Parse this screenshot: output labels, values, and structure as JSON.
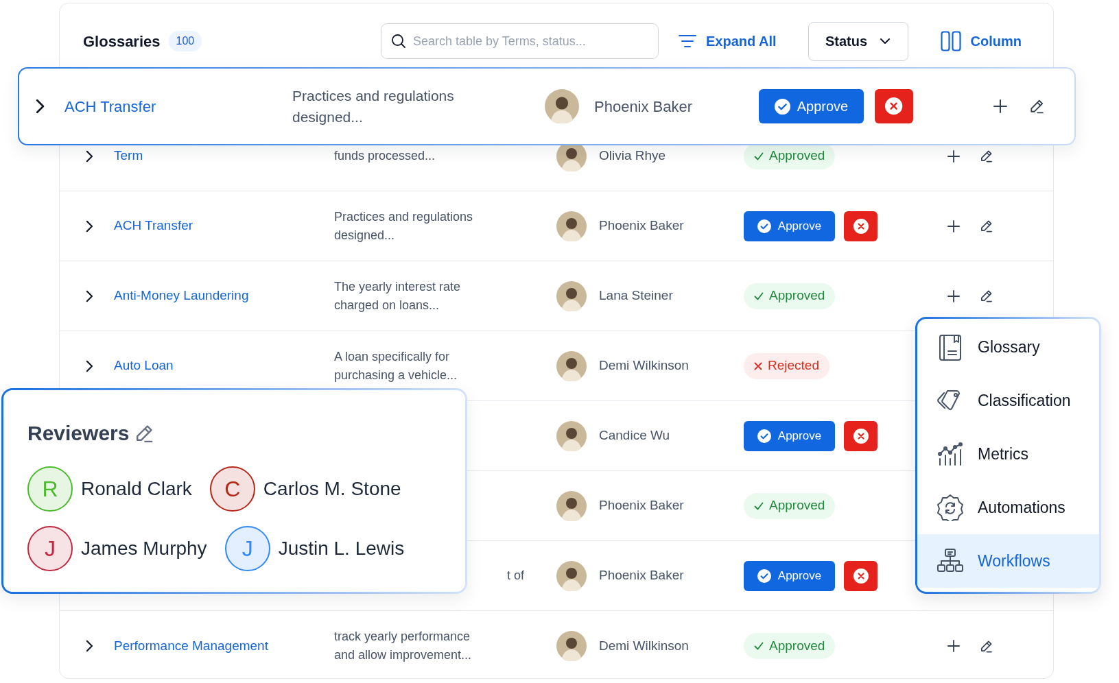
{
  "header": {
    "title": "Glossaries",
    "count": "100",
    "search": {
      "placeholder": "Search table by Terms, status..."
    },
    "expand_label": "Expand All",
    "status_filter": "Status",
    "column_label": "Column"
  },
  "highlighted_row": {
    "term": "ACH Transfer",
    "description": "Practices and regulations\ndesigned...",
    "reviewer": "Phoenix Baker",
    "status": {
      "kind": "pending",
      "label": "Approve"
    },
    "actions": true
  },
  "rows": [
    {
      "term": "Term",
      "description": "funds processed...",
      "reviewer": "Olivia Rhye",
      "status": {
        "kind": "approved",
        "label": "Approved"
      },
      "actions": true
    },
    {
      "term": "ACH Transfer",
      "description": "Practices and regulations\ndesigned...",
      "reviewer": "Phoenix Baker",
      "status": {
        "kind": "pending",
        "label": "Approve"
      },
      "actions": true
    },
    {
      "term": "Anti-Money Laundering",
      "description": "The yearly interest rate\ncharged on loans...",
      "reviewer": "Lana Steiner",
      "status": {
        "kind": "approved",
        "label": "Approved"
      },
      "actions": true
    },
    {
      "term": "Auto Loan",
      "description": "A loan specifically for\npurchasing a vehicle...",
      "reviewer": "Demi Wilkinson",
      "status": {
        "kind": "rejected",
        "label": "Rejected"
      },
      "actions": false
    },
    {
      "reviewer": "Candice Wu",
      "status": {
        "kind": "pending",
        "label": "Approve"
      },
      "actions": false
    },
    {
      "reviewer": "Phoenix Baker",
      "status": {
        "kind": "approved",
        "label": "Approved"
      },
      "actions": false
    },
    {
      "description": "t of",
      "description_partial": true,
      "reviewer": "Phoenix Baker",
      "status": {
        "kind": "pending",
        "label": "Approve"
      },
      "actions": false
    },
    {
      "term": "Performance Management",
      "description": "track yearly performance\nand allow improvement...",
      "reviewer": "Demi Wilkinson",
      "status": {
        "kind": "approved",
        "label": "Approved"
      },
      "actions": true
    }
  ],
  "reviewers": {
    "title": "Reviewers",
    "people": [
      {
        "initial": "R",
        "name": "Ronald Clark",
        "color": "#4cba2d"
      },
      {
        "initial": "C",
        "name": "Carlos M. Stone",
        "color": "#b4281a"
      },
      {
        "initial": "J",
        "name": "James Murphy",
        "color": "#c0283e"
      },
      {
        "initial": "J",
        "name": "Justin L. Lewis",
        "color": "#2f8af5"
      }
    ]
  },
  "menu": {
    "items": [
      {
        "label": "Glossary",
        "selected": false
      },
      {
        "label": "Classification",
        "selected": false
      },
      {
        "label": "Metrics",
        "selected": false
      },
      {
        "label": "Automations",
        "selected": false
      },
      {
        "label": "Workflows",
        "selected": true
      }
    ]
  }
}
